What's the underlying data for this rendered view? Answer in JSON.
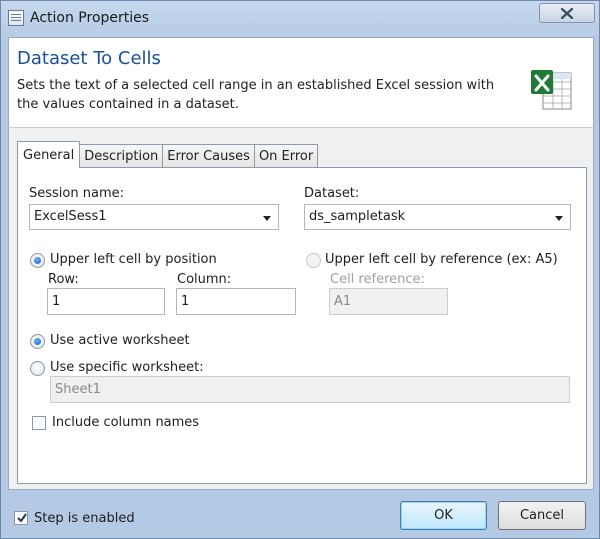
{
  "window": {
    "title": "Action Properties"
  },
  "header": {
    "title": "Dataset To Cells",
    "description": "Sets the text of a selected cell range in an established Excel session with the values contained in a dataset.",
    "icon": "excel-icon"
  },
  "tabs": [
    {
      "label": "General",
      "active": true
    },
    {
      "label": "Description",
      "active": false
    },
    {
      "label": "Error Causes",
      "active": false
    },
    {
      "label": "On Error",
      "active": false
    }
  ],
  "general": {
    "session_name_label": "Session name:",
    "session_name_value": "ExcelSess1",
    "dataset_label": "Dataset:",
    "dataset_value": "ds_sampletask",
    "position_option_label": "Upper left cell by position",
    "position_selected": true,
    "row_label": "Row:",
    "row_value": "1",
    "column_label": "Column:",
    "column_value": "1",
    "reference_option_label": "Upper left cell by reference (ex: A5)",
    "cell_reference_label": "Cell reference:",
    "cell_reference_value": "A1",
    "active_worksheet_label": "Use active worksheet",
    "active_worksheet_selected": true,
    "specific_worksheet_label": "Use specific worksheet:",
    "specific_worksheet_value": "Sheet1",
    "include_column_names_label": "Include column names",
    "include_column_names_checked": false
  },
  "footer": {
    "step_enabled_label": "Step is enabled",
    "step_enabled_checked": true,
    "ok_label": "OK",
    "cancel_label": "Cancel"
  },
  "colors": {
    "accent": "#1a4f9c",
    "frame": "#b4c9e4",
    "excel_green": "#1f7a36"
  }
}
